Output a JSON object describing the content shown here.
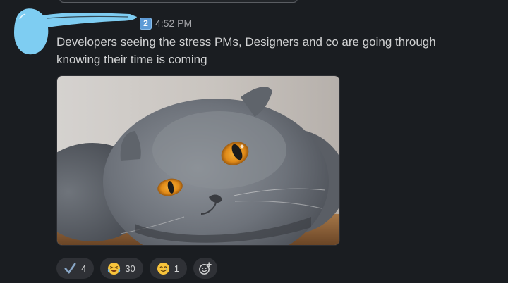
{
  "previous_message": {},
  "message": {
    "author": "",
    "badge_label": "2",
    "time": "4:52 PM",
    "text": "Developers seeing the stress PMs, Designers and co are going through knowing their time is coming",
    "image_subject": "grey-cat-photo"
  },
  "reactions": [
    {
      "icon": "checkmark-icon",
      "count": "4"
    },
    {
      "icon": "laughing-face-icon",
      "count": "30"
    },
    {
      "icon": "smiling-tear-face-icon",
      "count": "1"
    }
  ],
  "add_reaction": {
    "icon": "add-reaction-icon"
  },
  "colors": {
    "background": "#1a1d21",
    "text": "#d1d2d3",
    "timestamp": "#a6a7ab",
    "reaction_bg": "#2f3136",
    "redaction": "#7ecdf2",
    "badge": "#5e9bd6"
  }
}
